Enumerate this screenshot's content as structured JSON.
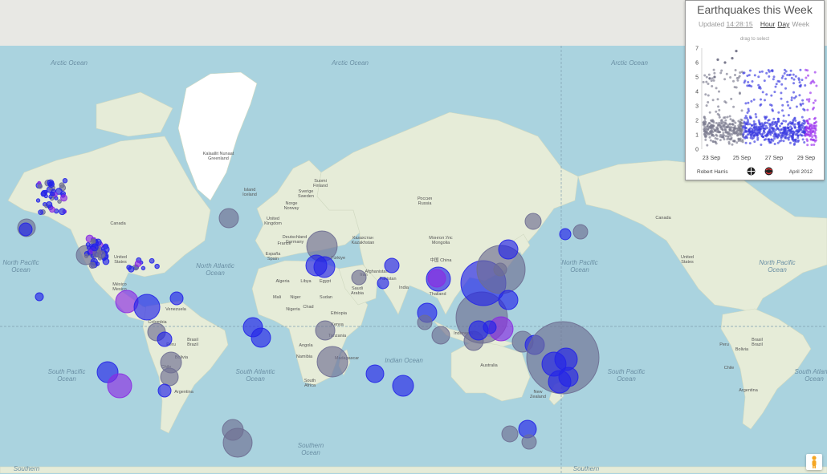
{
  "panel": {
    "title": "Earthquakes this Week",
    "updated_label": "Updated",
    "updated_time": "14:28:15",
    "ranges": [
      "Hour",
      "Day",
      "Week"
    ],
    "hint": "drag to select",
    "author": "Robert Harris",
    "date": "April 2012"
  },
  "chart_data": {
    "type": "scatter",
    "x_ticks": [
      "23 Sep",
      "25 Sep",
      "27 Sep",
      "29 Sep"
    ],
    "y_ticks": [
      "0",
      "1",
      "2",
      "3",
      "4",
      "5",
      "6",
      "7"
    ],
    "ylim": [
      0,
      7
    ],
    "xlabel": "",
    "ylabel": "",
    "grid": false,
    "colors": {
      "older": "#7a7a8e",
      "mid": "#3a3ae0",
      "recent": "#9a30ee"
    }
  },
  "map": {
    "ocean_labels": [
      "Arctic Ocean",
      "Arctic Ocean",
      "Arctic Ocean",
      "North Pacific Ocean",
      "North Atlantic Ocean",
      "North Pacific Ocean",
      "North Pacific Ocean",
      "South Pacific Ocean",
      "South Atlantic Ocean",
      "Indian Ocean",
      "South Pacific Ocean",
      "South Atlantic Ocean",
      "Southern Ocean",
      "Southern",
      "Southern"
    ],
    "country_labels": [
      "Kalaallit Nunaat Greenland",
      "Island Iceland",
      "Canada",
      "United States",
      "México Mexico",
      "Venezuela",
      "Colombia",
      "Brasil Brazil",
      "Peru",
      "Bolivia",
      "Argentina",
      "Chile",
      "Suomi Finland",
      "Sverige Sweden",
      "Norge Norway",
      "United Kingdom",
      "Deutschland Germany",
      "France",
      "España Spain",
      "Algeria",
      "Libya",
      "Egypt",
      "Mali",
      "Niger",
      "Chad",
      "Sudan",
      "Nigeria",
      "Ethiopia",
      "Kenya",
      "Tanzania",
      "Angola",
      "Namibia",
      "Madagascar",
      "South Africa",
      "Türkiye",
      "Iran",
      "Saudi Arabia",
      "Afghanistan",
      "Pakistan",
      "India",
      "Россия Russia",
      "Казахстан Kazakhstan",
      "Монгол Улс Mongolia",
      "中国 China",
      "Thailand",
      "Indonesia",
      "Australia",
      "New Zealand",
      "United States",
      "Canada",
      "Brasil Brazil",
      "Peru",
      "Bolivia",
      "Chile",
      "Argentina"
    ],
    "marker_colors": {
      "gray": "#6e6e92",
      "blue": "#2424e8",
      "purple": "#8a2be2"
    }
  },
  "controls": {
    "pegman": "pegman-icon"
  }
}
